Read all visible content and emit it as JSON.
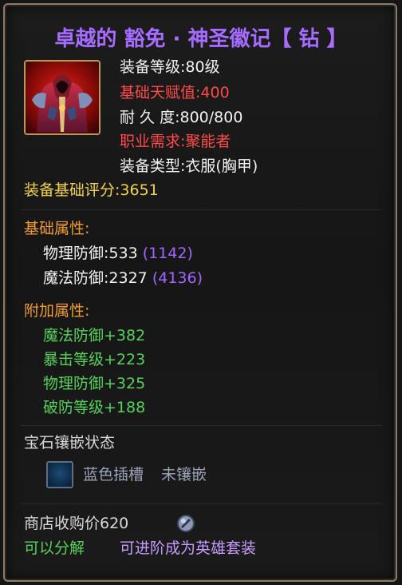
{
  "item": {
    "title": "卓越的 豁免 · 神圣徽记【 钻 】",
    "icon": "robe-armor-icon",
    "stats": {
      "level_label": "装备等级:",
      "level_value": "80级",
      "talent_label": "基础天赋值:",
      "talent_value": "400",
      "durability_label": "耐 久 度:",
      "durability_value": "800/800",
      "class_label": "职业需求:",
      "class_value": "聚能者",
      "type_label": "装备类型:",
      "type_value": "衣服(胸甲)"
    },
    "score_label": "装备基础评分:",
    "score_value": "3651",
    "base_attr_header": "基础属性:",
    "base_attrs": [
      {
        "name": "物理防御:533",
        "max": "(1142)"
      },
      {
        "name": "魔法防御:2327",
        "max": "(4136)"
      }
    ],
    "extra_attr_header": "附加属性:",
    "extra_attrs": [
      "魔法防御+382",
      "暴击等级+223",
      "物理防御+325",
      "破防等级+188"
    ],
    "gem_header": "宝石镶嵌状态",
    "gem_slot_label": "蓝色插槽",
    "gem_slot_status": "未镶嵌",
    "shop_price_label": "商店收购价620",
    "coin_icon": "silver-coin-icon",
    "decompose_label": "可以分解",
    "upgrade_label": "可进阶成为英雄套装"
  },
  "colors": {
    "title": "#a66cff",
    "gold": "#f3d34a",
    "header_orange": "#f19b2e",
    "red": "#ff4a4a",
    "green": "#55d25a",
    "purple": "#a066ff",
    "lilac": "#c79cff",
    "border": "#8a7b66"
  }
}
